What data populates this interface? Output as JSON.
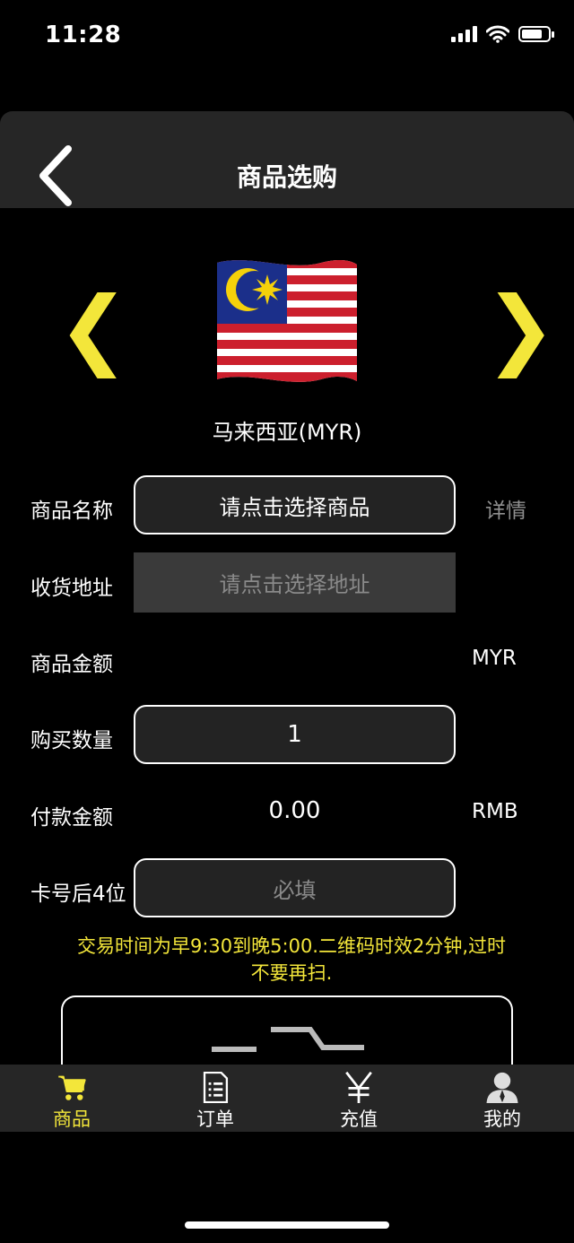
{
  "status_bar": {
    "time": "11:28"
  },
  "nav": {
    "title": "商品选购"
  },
  "country": {
    "name": "马来西亚(MYR)"
  },
  "form": {
    "product_name": {
      "label": "商品名称",
      "value": "请点击选择商品",
      "detail_link": "详情"
    },
    "address": {
      "label": "收货地址",
      "placeholder": "请点击选择地址"
    },
    "product_amount": {
      "label": "商品金额",
      "currency": "MYR"
    },
    "quantity": {
      "label": "购买数量",
      "value": "1"
    },
    "payment_amount": {
      "label": "付款金额",
      "value": "0.00",
      "currency": "RMB"
    },
    "card_last4": {
      "label": "卡号后4位",
      "placeholder": "必填"
    }
  },
  "notice": "交易时间为早9:30到晚5:00.二维码时效2分钟,过时不要再扫.",
  "tabbar": {
    "items": [
      {
        "label": "商品",
        "icon": "cart-icon",
        "active": true
      },
      {
        "label": "订单",
        "icon": "order-list-icon",
        "active": false
      },
      {
        "label": "充值",
        "icon": "yuan-icon",
        "active": false
      },
      {
        "label": "我的",
        "icon": "user-icon",
        "active": false
      }
    ]
  },
  "colors": {
    "accent": "#f3e63a",
    "background": "#000000",
    "bar": "#262626"
  }
}
